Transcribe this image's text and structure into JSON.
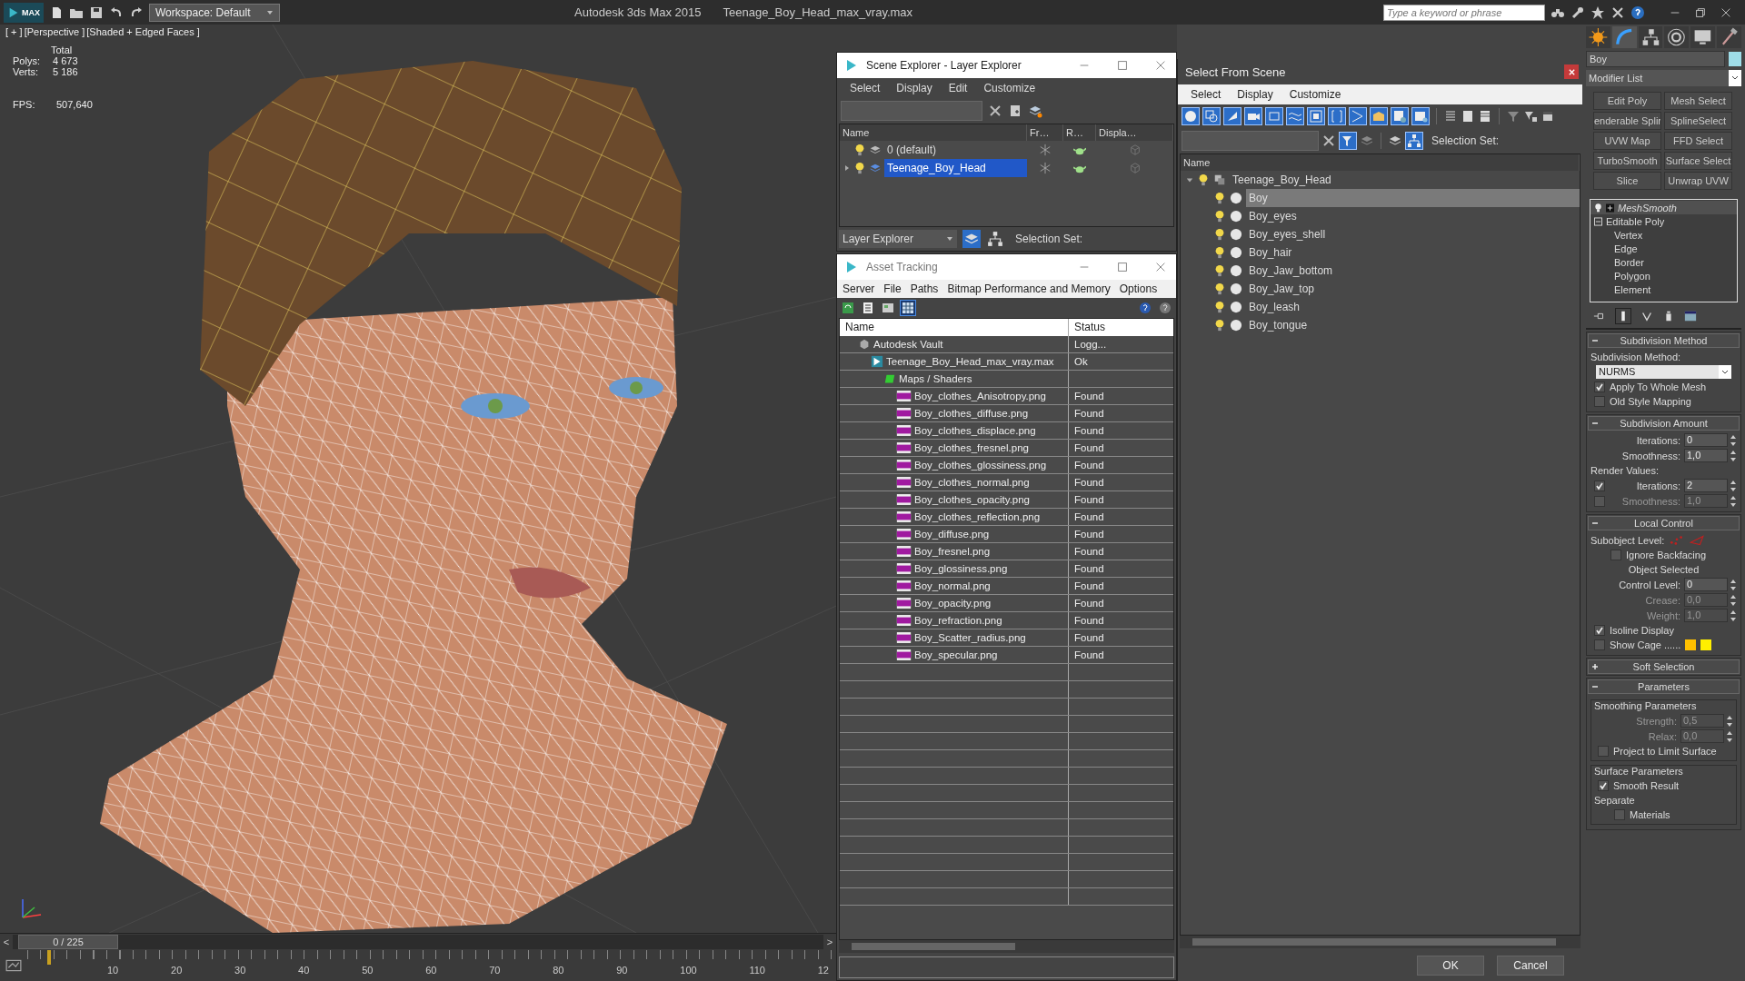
{
  "app_bar": {
    "logo": "MAX",
    "workspace": "Workspace: Default",
    "title": "Autodesk 3ds Max  2015",
    "file": "Teenage_Boy_Head_max_vray.max",
    "search": {
      "placeholder": "Type a keyword or phrase"
    }
  },
  "viewport": {
    "labels": [
      "[ + ]",
      "[Perspective ]",
      "[Shaded + Edged Faces ]"
    ],
    "stats_title": "Total",
    "stats": [
      {
        "label": "Polys:",
        "value": "4 673"
      },
      {
        "label": "Verts:",
        "value": "5 186"
      }
    ],
    "fps": {
      "label": "FPS:",
      "value": "507,640"
    }
  },
  "timeline": {
    "prev": "<",
    "frame": "0 / 225",
    "next": ">",
    "level": 0,
    "ticks": [
      "10",
      "20",
      "30",
      "40",
      "50",
      "60",
      "70",
      "80",
      "90",
      "100",
      "110",
      "12"
    ]
  },
  "scene_explorer": {
    "title": "Scene Explorer - Layer Explorer",
    "menu": [
      "Select",
      "Display",
      "Edit",
      "Customize"
    ],
    "columns": [
      "Name",
      "Fr…",
      "R…",
      "Displa…"
    ],
    "rows": [
      {
        "name": "0 (default)",
        "selected": false,
        "expandable": false
      },
      {
        "name": "Teenage_Boy_Head",
        "selected": true,
        "expandable": true
      }
    ],
    "mode": "Layer Explorer",
    "selection_set": "Selection Set:"
  },
  "asset_tracking": {
    "title": "Asset Tracking",
    "menu": [
      "Server",
      "File",
      "Paths",
      "Bitmap Performance and Memory",
      "Options"
    ],
    "columns": [
      "Name",
      "Status"
    ],
    "tree": [
      {
        "name": "Autodesk Vault",
        "status": "Logg...",
        "kind": "vault",
        "children": [
          {
            "name": "Teenage_Boy_Head_max_vray.max",
            "status": "Ok",
            "kind": "scene",
            "children": [
              {
                "name": "Maps / Shaders",
                "kind": "maps",
                "children": [
                  {
                    "name": "Boy_clothes_Anisotropy.png",
                    "status": "Found",
                    "kind": "png"
                  },
                  {
                    "name": "Boy_clothes_diffuse.png",
                    "status": "Found",
                    "kind": "png"
                  },
                  {
                    "name": "Boy_clothes_displace.png",
                    "status": "Found",
                    "kind": "png"
                  },
                  {
                    "name": "Boy_clothes_fresnel.png",
                    "status": "Found",
                    "kind": "png"
                  },
                  {
                    "name": "Boy_clothes_glossiness.png",
                    "status": "Found",
                    "kind": "png"
                  },
                  {
                    "name": "Boy_clothes_normal.png",
                    "status": "Found",
                    "kind": "png"
                  },
                  {
                    "name": "Boy_clothes_opacity.png",
                    "status": "Found",
                    "kind": "png"
                  },
                  {
                    "name": "Boy_clothes_reflection.png",
                    "status": "Found",
                    "kind": "png"
                  },
                  {
                    "name": "Boy_diffuse.png",
                    "status": "Found",
                    "kind": "png"
                  },
                  {
                    "name": "Boy_fresnel.png",
                    "status": "Found",
                    "kind": "png"
                  },
                  {
                    "name": "Boy_glossiness.png",
                    "status": "Found",
                    "kind": "png"
                  },
                  {
                    "name": "Boy_normal.png",
                    "status": "Found",
                    "kind": "png"
                  },
                  {
                    "name": "Boy_opacity.png",
                    "status": "Found",
                    "kind": "png"
                  },
                  {
                    "name": "Boy_refraction.png",
                    "status": "Found",
                    "kind": "png"
                  },
                  {
                    "name": "Boy_Scatter_radius.png",
                    "status": "Found",
                    "kind": "png"
                  },
                  {
                    "name": "Boy_specular.png",
                    "status": "Found",
                    "kind": "png"
                  }
                ]
              }
            ]
          }
        ]
      }
    ]
  },
  "select_from_scene": {
    "title": "Select From Scene",
    "menu": [
      "Select",
      "Display",
      "Customize"
    ],
    "selection_set": "Selection Set:",
    "column": "Name",
    "tree": {
      "name": "Teenage_Boy_Head",
      "expanded": true,
      "children": [
        {
          "name": "Boy",
          "selected": true
        },
        {
          "name": "Boy_eyes",
          "selected": false
        },
        {
          "name": "Boy_eyes_shell",
          "selected": false
        },
        {
          "name": "Boy_hair",
          "selected": false
        },
        {
          "name": "Boy_Jaw_bottom",
          "selected": false
        },
        {
          "name": "Boy_Jaw_top",
          "selected": false
        },
        {
          "name": "Boy_leash",
          "selected": false
        },
        {
          "name": "Boy_tongue",
          "selected": false
        }
      ]
    },
    "buttons": [
      "OK",
      "Cancel"
    ]
  },
  "command_panel": {
    "object_name": "Boy",
    "modifier_list": "Modifier List",
    "modifier_buttons": [
      "Edit Poly",
      "Mesh Select",
      "enderable Splir",
      "SplineSelect",
      "UVW Map",
      "FFD Select",
      "TurboSmooth",
      "Surface Select",
      "Slice",
      "Unwrap UVW"
    ],
    "stack": [
      {
        "name": "MeshSmooth",
        "kind": "modifier"
      },
      {
        "name": "Editable Poly",
        "kind": "base",
        "children": [
          "Vertex",
          "Edge",
          "Border",
          "Polygon",
          "Element"
        ]
      }
    ],
    "rollouts": [
      {
        "title": "Subdivision Method",
        "expanded": true,
        "items": [
          {
            "kind": "label",
            "label": "Subdivision Method:"
          },
          {
            "kind": "dropdown",
            "value": "NURMS"
          },
          {
            "kind": "checkbox",
            "label": "Apply To Whole Mesh",
            "checked": true
          },
          {
            "kind": "checkbox",
            "label": "Old Style Mapping",
            "checked": false
          }
        ]
      },
      {
        "title": "Subdivision Amount",
        "expanded": true,
        "items": [
          {
            "kind": "spinner",
            "label": "Iterations:",
            "value": "0",
            "disabled": false
          },
          {
            "kind": "spinner",
            "label": "Smoothness:",
            "value": "1,0",
            "disabled": false
          },
          {
            "kind": "label",
            "label": "Render Values:"
          },
          {
            "kind": "check_spinner",
            "label": "Iterations:",
            "value": "2",
            "checked": true,
            "disabled": false
          },
          {
            "kind": "check_spinner",
            "label": "Smoothness:",
            "value": "1,0",
            "checked": false,
            "disabled": true
          }
        ]
      },
      {
        "title": "Local Control",
        "expanded": true,
        "items": [
          {
            "kind": "subobject",
            "label": "Subobject Level:"
          },
          {
            "kind": "checkbox_indented",
            "label": "Ignore Backfacing",
            "checked": false
          },
          {
            "kind": "text",
            "label": "Object Selected"
          },
          {
            "kind": "spinner",
            "label": "Control Level:",
            "value": "0",
            "disabled": false
          },
          {
            "kind": "spinner",
            "label": "Crease:",
            "value": "0,0",
            "disabled": true
          },
          {
            "kind": "spinner",
            "label": "Weight:",
            "value": "1,0",
            "disabled": true
          },
          {
            "kind": "checkbox",
            "label": "Isoline Display",
            "checked": true
          },
          {
            "kind": "cage",
            "label": "Show Cage ......",
            "checked": false,
            "swatches": [
              {
                "color": "#ffc000"
              },
              {
                "color": "#ffef00"
              }
            ]
          }
        ]
      },
      {
        "title": "Soft Selection",
        "expanded": false
      },
      {
        "title": "Parameters",
        "expanded": true,
        "items": [
          {
            "kind": "group",
            "label": "Smoothing Parameters",
            "items": [
              {
                "kind": "spinner",
                "label": "Strength:",
                "value": "0,5",
                "disabled": true
              },
              {
                "kind": "spinner",
                "label": "Relax:",
                "value": "0,0",
                "disabled": true
              },
              {
                "kind": "checkbox",
                "label": "Project to Limit Surface",
                "checked": false
              }
            ]
          },
          {
            "kind": "group",
            "label": "Surface Parameters",
            "items": [
              {
                "kind": "checkbox",
                "label": "Smooth Result",
                "checked": true
              },
              {
                "kind": "label",
                "label": "Separate"
              },
              {
                "kind": "checkbox_indented",
                "label": "Materials",
                "checked": false
              }
            ]
          }
        ]
      }
    ]
  }
}
